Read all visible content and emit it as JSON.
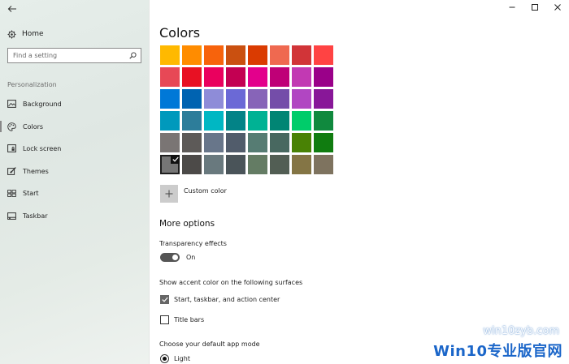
{
  "sidebar": {
    "home_label": "Home",
    "search_placeholder": "Find a setting",
    "section_title": "Personalization",
    "items": [
      {
        "label": "Background",
        "icon": "picture-icon"
      },
      {
        "label": "Colors",
        "icon": "palette-icon",
        "active": true
      },
      {
        "label": "Lock screen",
        "icon": "lock-screen-icon"
      },
      {
        "label": "Themes",
        "icon": "brush-icon"
      },
      {
        "label": "Start",
        "icon": "start-icon"
      },
      {
        "label": "Taskbar",
        "icon": "taskbar-icon"
      }
    ]
  },
  "main": {
    "title": "Colors",
    "swatches": [
      "#ffb900",
      "#ff8c00",
      "#f7630c",
      "#ca5010",
      "#da3b01",
      "#ef6950",
      "#d13438",
      "#ff4343",
      "#e74856",
      "#e81123",
      "#ea005e",
      "#c30052",
      "#e3008c",
      "#bf0077",
      "#c239b3",
      "#9a0089",
      "#0078d7",
      "#0063b1",
      "#8e8cd8",
      "#6b69d6",
      "#8764b8",
      "#744da9",
      "#b146c2",
      "#881798",
      "#0099bc",
      "#2d7d9a",
      "#00b7c3",
      "#038387",
      "#00b294",
      "#018574",
      "#00cc6a",
      "#10893e",
      "#7a7574",
      "#5d5a58",
      "#68768a",
      "#515c6b",
      "#567c73",
      "#486860",
      "#498205",
      "#107c10",
      "#767676",
      "#4c4a48",
      "#69797e",
      "#4a5459",
      "#647c64",
      "#525e54",
      "#847545",
      "#7e735f"
    ],
    "selected_swatch_index": 40,
    "custom_color_label": "Custom color",
    "more_options_title": "More options",
    "transparency_label": "Transparency effects",
    "transparency_state": "On",
    "accent_surfaces_label": "Show accent color on the following surfaces",
    "checkbox_start": "Start, taskbar, and action center",
    "checkbox_title_bars": "Title bars",
    "app_mode_label": "Choose your default app mode",
    "app_mode_light": "Light"
  },
  "watermark": {
    "url": "win10zyb.com",
    "brand": "Win10专业版官网"
  }
}
